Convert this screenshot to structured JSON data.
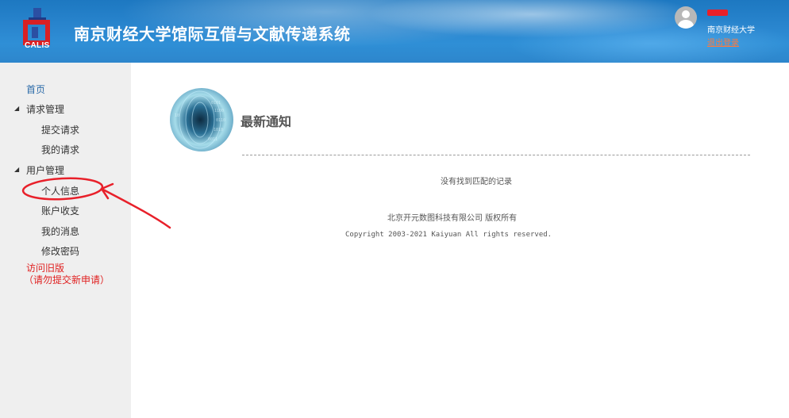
{
  "header": {
    "logo_text": "CALIS",
    "title": "南京财经大学馆际互借与文献传递系统",
    "user": {
      "org": "南京财经大学",
      "logout": "退出登录"
    }
  },
  "sidebar": {
    "items": [
      {
        "label": "首页",
        "type": "link"
      },
      {
        "label": "请求管理",
        "type": "section",
        "expanded": true
      },
      {
        "label": "提交请求",
        "type": "child"
      },
      {
        "label": "我的请求",
        "type": "child"
      },
      {
        "label": "用户管理",
        "type": "section",
        "expanded": true
      },
      {
        "label": "个人信息",
        "type": "child",
        "highlighted": true
      },
      {
        "label": "账户收支",
        "type": "child"
      },
      {
        "label": "我的消息",
        "type": "child"
      },
      {
        "label": "修改密码",
        "type": "child"
      }
    ],
    "old_version": {
      "line1": "访问旧版",
      "line2": "（请勿提交新申请）"
    }
  },
  "main": {
    "notice_title": "最新通知",
    "empty_message": "没有找到匹配的记录",
    "footer_company": "北京开元数图科技有限公司 版权所有",
    "footer_copyright": "Copyright 2003-2021 Kaiyuan All rights reserved."
  },
  "colors": {
    "header_blue": "#2a86cf",
    "link_blue": "#2a6aa8",
    "red": "#e02020",
    "logout_orange": "#ff7a3c"
  }
}
